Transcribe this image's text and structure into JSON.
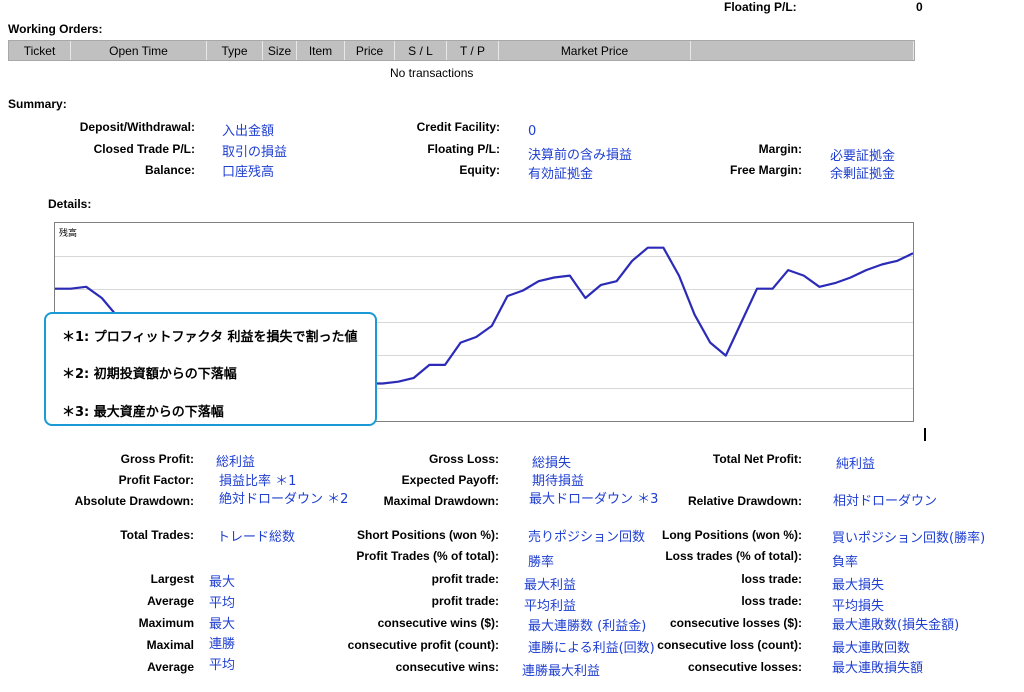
{
  "header": {
    "floating_pl_label": "Floating P/L:",
    "floating_pl_value": "0"
  },
  "working_orders": {
    "title": "Working Orders:",
    "columns": [
      "Ticket",
      "Open Time",
      "Type",
      "Size",
      "Item",
      "Price",
      "S / L",
      "T / P",
      "Market Price",
      ""
    ],
    "empty_text": "No transactions"
  },
  "summary": {
    "title": "Summary:",
    "deposit_label": "Deposit/Withdrawal:",
    "deposit_value": "入出金額",
    "closed_label": "Closed Trade P/L:",
    "closed_value": "取引の損益",
    "balance_label": "Balance:",
    "balance_value": "口座残高",
    "credit_label": "Credit Facility:",
    "credit_value": "0",
    "floating_label": "Floating P/L:",
    "floating_value": "決算前の含み損益",
    "equity_label": "Equity:",
    "equity_value": "有効証拠金",
    "margin_label": "Margin:",
    "margin_value": "必要証拠金",
    "free_margin_label": "Free Margin:",
    "free_margin_value": "余剰証拠金"
  },
  "details": {
    "title": "Details:",
    "chart_label": "残高",
    "notes": [
      "＊1:  プロフィットファクタ  利益を損失で割った値",
      "＊2:  初期投資額からの下落幅",
      "＊3:  最大資産からの下落幅"
    ]
  },
  "chart_data": {
    "type": "line",
    "title": "残高",
    "series": [
      {
        "values": [
          0.69,
          0.69,
          0.7,
          0.64,
          0.54,
          0.44,
          0.39,
          0.35,
          0.35,
          0.31,
          0.29,
          0.28,
          0.2,
          0.15,
          0.05,
          0.05,
          0.06,
          0.08,
          0.09,
          0.2,
          0.18,
          0.18,
          0.19,
          0.21,
          0.28,
          0.28,
          0.4,
          0.43,
          0.49,
          0.65,
          0.68,
          0.73,
          0.75,
          0.76,
          0.64,
          0.71,
          0.73,
          0.84,
          0.91,
          0.91,
          0.76,
          0.55,
          0.4,
          0.33,
          0.51,
          0.69,
          0.69,
          0.79,
          0.76,
          0.7,
          0.72,
          0.75,
          0.79,
          0.82,
          0.84,
          0.88
        ]
      }
    ],
    "grid": true,
    "color": "#2b2bb8"
  },
  "stats": {
    "gross_profit_label": "Gross Profit:",
    "gross_profit_value": "総利益",
    "gross_loss_label": "Gross Loss:",
    "gross_loss_value": "総損失",
    "total_net_label": "Total Net Profit:",
    "total_net_value": "純利益",
    "profit_factor_label": "Profit Factor:",
    "profit_factor_value": "損益比率  ＊1",
    "expected_payoff_label": "Expected Payoff:",
    "expected_payoff_value": "期待損益",
    "abs_dd_label": "Absolute Drawdown:",
    "abs_dd_value": "絶対ドローダウン  ＊2",
    "max_dd_label": "Maximal Drawdown:",
    "max_dd_value": "最大ドローダウン  ＊3",
    "rel_dd_label": "Relative Drawdown:",
    "rel_dd_value": "相対ドローダウン",
    "total_trades_label": "Total Trades:",
    "total_trades_value": "トレード総数",
    "short_label": "Short Positions (won %):",
    "short_value": "売りポジション回数",
    "long_label": "Long Positions (won %):",
    "long_value": "買いポジション回数(勝率)",
    "profit_trades_label": "Profit Trades (% of total):",
    "profit_trades_value": "勝率",
    "loss_trades_label": "Loss trades (% of total):",
    "loss_trades_value": "負率",
    "largest_label": "Largest",
    "largest_value": "最大",
    "largest_profit_label": "profit trade:",
    "largest_profit_value": "最大利益",
    "largest_loss_label": "loss trade:",
    "largest_loss_value": "最大損失",
    "average_label": "Average",
    "average_value": "平均",
    "average_profit_label": "profit trade:",
    "average_profit_value": "平均利益",
    "average_loss_label": "loss trade:",
    "average_loss_value": "平均損失",
    "maximum_label": "Maximum",
    "maximum_value": "最大",
    "max_cons_wins_label": "consecutive wins ($):",
    "max_cons_wins_value": "最大連勝数  (利益金)",
    "max_cons_losses_label": "consecutive losses ($):",
    "max_cons_losses_value": "最大連敗数(損失金額)",
    "maximal_label": "Maximal",
    "maximal_value": "連勝",
    "maximal_profit_label": "consecutive profit (count):",
    "maximal_profit_value": "連勝による利益(回数)",
    "maximal_loss_label": "consecutive loss (count):",
    "maximal_loss_value": "最大連敗回数",
    "avg2_label": "Average",
    "avg2_value": "平均",
    "avg_cons_wins_label": "consecutive wins:",
    "avg_cons_wins_value": "連勝最大利益",
    "avg_cons_losses_label": "consecutive losses:",
    "avg_cons_losses_value": "最大連敗損失額"
  }
}
